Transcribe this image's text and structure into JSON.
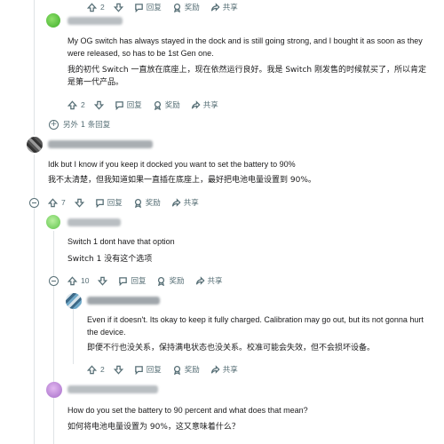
{
  "actions": {
    "reply": "回复",
    "award": "奖励",
    "share": "共享"
  },
  "comments": [
    {
      "id": "top-partial",
      "votes": "2"
    },
    {
      "id": "c1",
      "text_en": "My OG switch has always stayed in the dock and is still going strong, and I bought it as soon as they were released, so has to be 1st Gen one.",
      "text_zh": "我的初代 Switch 一直放在底座上，现在依然运行良好。我是 Switch 刚发售的时候就买了，所以肯定是第一代产品。",
      "votes": "2",
      "more_replies": "另外 1 条回复"
    },
    {
      "id": "c2",
      "text_en": "Idk but I know if you keep it docked you want to set the battery to 90%",
      "text_zh": "我不太清楚，但我知道如果一直插在底座上，最好把电池电量设置到 90%。",
      "votes": "7"
    },
    {
      "id": "c3",
      "text_en": "Switch 1 dont have that option",
      "text_zh": "Switch 1 没有这个选项",
      "votes": "10"
    },
    {
      "id": "c4",
      "text_en": "Even if it doesn't. Its okay to keep it fully charged. Calibration may go out, but its not gonna hurt the device.",
      "text_zh": "即便不行也没关系，保持满电状态也没关系。校准可能会失效，但不会损坏设备。",
      "votes": "2"
    },
    {
      "id": "c5",
      "text_en": "How do you set the battery to 90 percent and what does that mean?",
      "text_zh": "如何将电池电量设置为 90%，这又意味着什么？"
    }
  ],
  "icons": {
    "upvote": "arrow-up-icon",
    "downvote": "arrow-down-icon",
    "reply": "comment-bubble-icon",
    "award": "award-icon",
    "share": "share-icon",
    "collapse": "collapse-circle-icon",
    "expand": "plus-circle-icon"
  },
  "colors": {
    "meta_text": "#576f76",
    "thread_line": "#dfe3e6",
    "body_text": "#1a1a1b"
  }
}
